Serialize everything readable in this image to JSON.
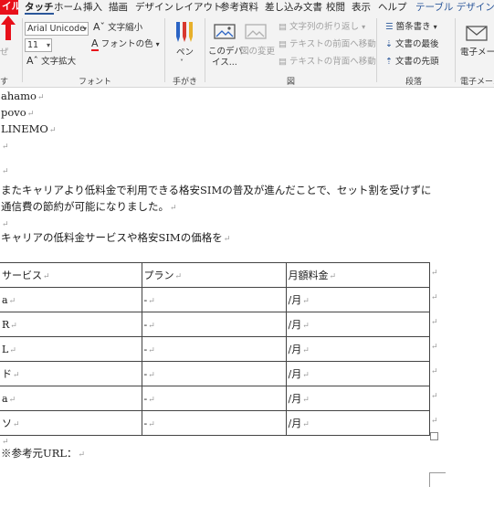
{
  "ribbon": {
    "tabs": [
      "イル",
      "タッチ",
      "ホーム",
      "挿入",
      "描画",
      "デザイン",
      "レイアウト",
      "参考資料",
      "差し込み文書",
      "校閲",
      "表示",
      "ヘルプ",
      "テーブル デザイン"
    ],
    "font": {
      "name": "Arial Unicode",
      "size": "11",
      "shrink_label": "文字縮小",
      "grow_label": "文字拡大",
      "color_label": "フォントの色",
      "group": "フォント"
    },
    "left_partial": {
      "label": "ぜ",
      "group": "す"
    },
    "pen": {
      "label": "ペン",
      "group": "手がき"
    },
    "figure": {
      "this_device_label_1": "このデバ",
      "this_device_label_2": "イス...",
      "change_image_label": "図の変更",
      "wrap_text": "文字列の折り返し",
      "bring_forward": "テキストの前面へ移動",
      "send_backward": "テキストの背面へ移動",
      "group": "図"
    },
    "paragraph": {
      "bullets": "箇条書き",
      "to_end": "文書の最後",
      "to_start": "文書の先頭",
      "group": "段落"
    },
    "email": {
      "label": "電子メール",
      "group": "電子メール"
    }
  },
  "document": {
    "lines": [
      "ahamo",
      "povo",
      "LINEMO",
      "",
      "",
      "またキャリアより低料金で利用できる格安SIMの普及が進んだことで、セット割を受けずに",
      "通信費の節約が可能になりました。",
      "",
      "キャリアの低料金サービスや格安SIMの価格を"
    ],
    "table": {
      "headers": [
        "サービス",
        "プラン",
        "月額料金"
      ],
      "rows": [
        [
          "a",
          "-",
          "/月"
        ],
        [
          "R",
          "-",
          "/月"
        ],
        [
          "L",
          "-",
          "/月"
        ],
        [
          "ド",
          "-",
          "/月"
        ],
        [
          "a",
          "-",
          "/月"
        ],
        [
          "ソ",
          "-",
          "/月"
        ]
      ]
    },
    "after_table": "",
    "reference": "※参考元URL："
  },
  "colors": {
    "accent": "#2b579a",
    "file_tab": "#e8101a"
  }
}
